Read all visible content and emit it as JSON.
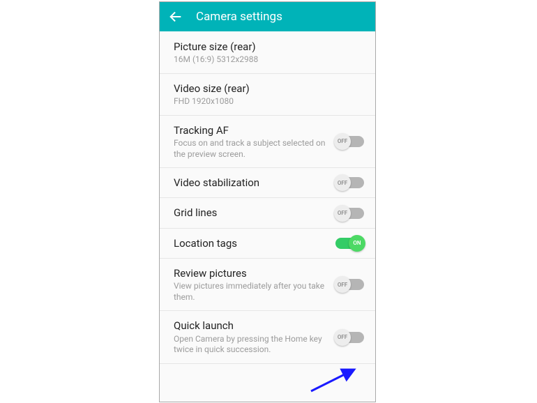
{
  "header": {
    "title": "Camera settings"
  },
  "items": [
    {
      "id": "picture-size-rear",
      "title": "Picture size (rear)",
      "subtitle": "16M (16:9) 5312x2988",
      "hasToggle": false
    },
    {
      "id": "video-size-rear",
      "title": "Video size (rear)",
      "subtitle": "FHD 1920x1080",
      "hasToggle": false
    },
    {
      "id": "tracking-af",
      "title": "Tracking AF",
      "subtitle": "Focus on and track a subject selected on the preview screen.",
      "hasToggle": true,
      "toggleState": "off"
    },
    {
      "id": "video-stabilization",
      "title": "Video stabilization",
      "subtitle": "",
      "hasToggle": true,
      "toggleState": "off"
    },
    {
      "id": "grid-lines",
      "title": "Grid lines",
      "subtitle": "",
      "hasToggle": true,
      "toggleState": "off"
    },
    {
      "id": "location-tags",
      "title": "Location tags",
      "subtitle": "",
      "hasToggle": true,
      "toggleState": "on"
    },
    {
      "id": "review-pictures",
      "title": "Review pictures",
      "subtitle": "View pictures immediately after you take them.",
      "hasToggle": true,
      "toggleState": "off"
    },
    {
      "id": "quick-launch",
      "title": "Quick launch",
      "subtitle": "Open Camera by pressing the Home key twice in quick succession.",
      "hasToggle": true,
      "toggleState": "off"
    }
  ],
  "toggleLabels": {
    "off": "OFF",
    "on": "ON"
  },
  "colors": {
    "headerBg": "#00b3b8",
    "toggleOn": "#33cc66",
    "toggleOffTrack": "#b5b5b5",
    "annotationArrow": "#1a1aff"
  }
}
